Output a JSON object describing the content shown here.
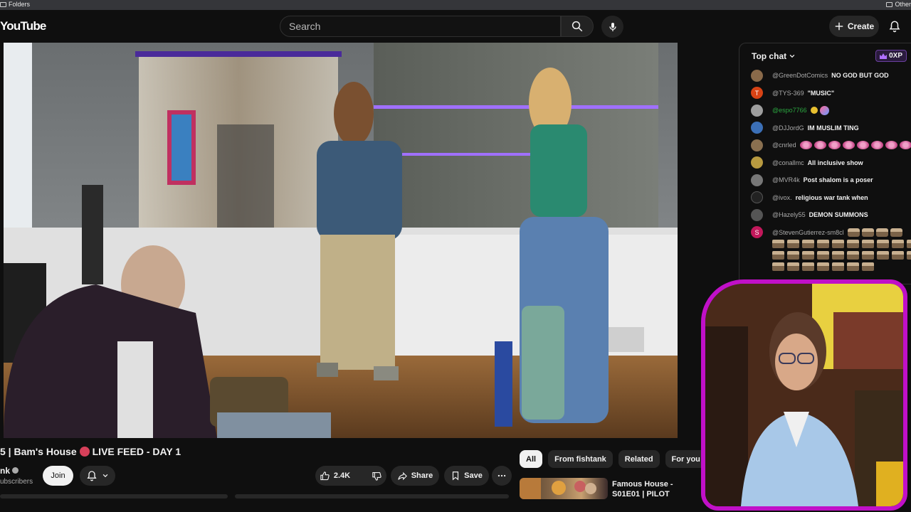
{
  "bookmarks": {
    "left_label": "Folders",
    "right_label": "Other"
  },
  "masthead": {
    "logo": "YouTube",
    "search_placeholder": "Search",
    "create_label": "Create"
  },
  "video": {
    "title": "5 | Bam's House",
    "title_suffix": "LIVE FEED - DAY 1",
    "channel": "nk",
    "subscribers": "ubscribers",
    "join_label": "Join",
    "likes": "2.4K",
    "share_label": "Share",
    "save_label": "Save"
  },
  "chips": [
    "All",
    "From fishtank",
    "Related",
    "For you"
  ],
  "recommendation": {
    "title": "Famous House - S01E01 | PILOT"
  },
  "chat": {
    "header": "Top chat",
    "xp_badge": "0XP",
    "messages": [
      {
        "author": "@GreenDotComics",
        "text": "NO GOD BUT GOD",
        "avatar_color": "#8a6a4a",
        "initial": ""
      },
      {
        "author": "@TYS-369",
        "text": "\"MUSIC\"",
        "avatar_color": "#d84315",
        "initial": "T"
      },
      {
        "author": "@espo7766",
        "text": "",
        "avatar_color": "#9e9e9e",
        "initial": "",
        "highlight": true
      },
      {
        "author": "@DJJordG",
        "text": "IM MUSLIM TING",
        "avatar_color": "#3b6fb6",
        "initial": ""
      },
      {
        "author": "@cnrled",
        "text": "",
        "avatar_color": "#8a7050",
        "initial": ""
      },
      {
        "author": "@conallmc",
        "text": "All inclusive show",
        "avatar_color": "#b89a40",
        "initial": ""
      },
      {
        "author": "@MVR4k",
        "text": "Post shalom is a poser",
        "avatar_color": "#777777",
        "initial": ""
      },
      {
        "author": "@ivox.",
        "text": "religious war tank when",
        "avatar_color": "#222222",
        "initial": ""
      },
      {
        "author": "@Hazely55",
        "text": "DEMON SUMMONS",
        "avatar_color": "#555555",
        "initial": ""
      },
      {
        "author": "@StevenGutierrez-sm8cl",
        "text": "",
        "avatar_color": "#c2185b",
        "initial": "S"
      }
    ]
  },
  "colors": {
    "accent_red": "#ff0000",
    "webcam_border": "#c010c8",
    "chat_green": "#2ba640"
  }
}
